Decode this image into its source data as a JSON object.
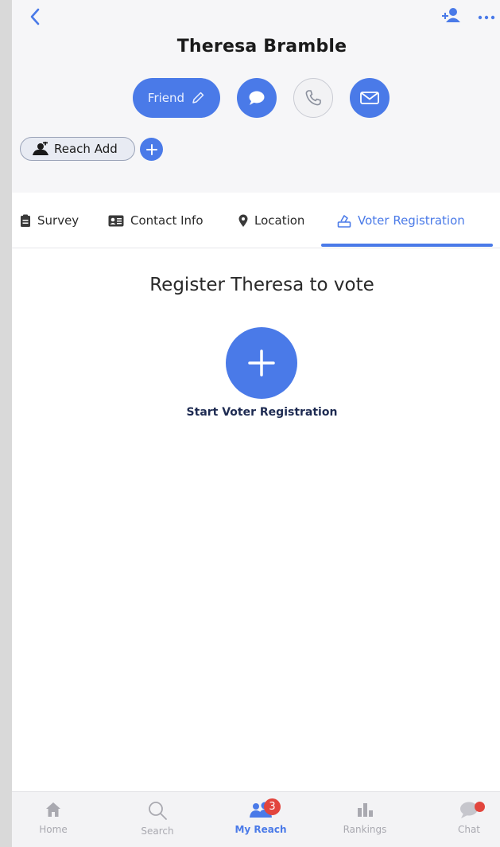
{
  "header": {
    "name": "Theresa Bramble",
    "back_icon": "chevron-left-icon",
    "add_person_icon": "add-person-icon",
    "more_icon": "more-horizontal-icon"
  },
  "actions": {
    "friend_label": "Friend",
    "friend_icon": "pencil-icon",
    "chat_icon": "chat-bubble-icon",
    "call_icon": "phone-icon",
    "mail_icon": "mail-icon"
  },
  "reach_add": {
    "label": "Reach Add",
    "icon": "add-group-icon",
    "plus_icon": "plus-icon"
  },
  "tabs": [
    {
      "label": "Survey",
      "icon": "clipboard-icon",
      "active": false
    },
    {
      "label": "Contact Info",
      "icon": "contact-card-icon",
      "active": false
    },
    {
      "label": "Location",
      "icon": "map-pin-icon",
      "active": false
    },
    {
      "label": "Voter Registration",
      "icon": "vote-icon",
      "active": true
    }
  ],
  "main": {
    "title": "Register Theresa to vote",
    "start_label": "Start Voter Registration",
    "start_icon": "plus-icon"
  },
  "bottom_nav": [
    {
      "label": "Home",
      "icon": "home-icon",
      "active": false
    },
    {
      "label": "Search",
      "icon": "search-icon",
      "active": false
    },
    {
      "label": "My Reach",
      "icon": "people-icon",
      "active": true,
      "badge": "3"
    },
    {
      "label": "Rankings",
      "icon": "bar-chart-icon",
      "active": false
    },
    {
      "label": "Chat",
      "icon": "chat-icon",
      "active": false
    }
  ],
  "colors": {
    "accent": "#4a7ae8",
    "badge": "#e2453d",
    "header_bg": "#f6f6f8",
    "nav_inactive": "#a9a9b0"
  }
}
